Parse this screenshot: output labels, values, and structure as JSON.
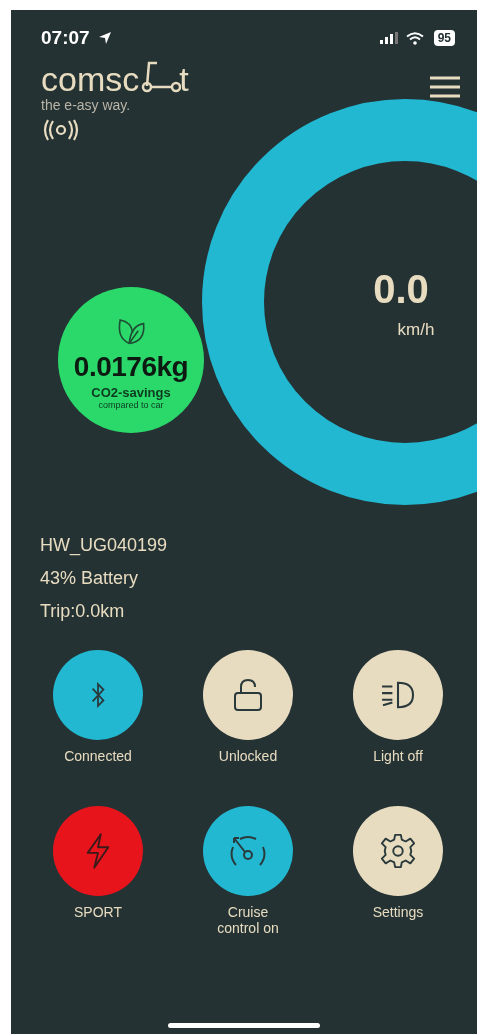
{
  "status_bar": {
    "time": "07:07",
    "battery": "95"
  },
  "logo": {
    "text_start": "comsc",
    "text_end": "t",
    "tagline": "the e-asy way."
  },
  "speed": {
    "value": "0.0",
    "unit": "km/h"
  },
  "co2": {
    "amount": "0.0176kg",
    "label": "CO2-savings",
    "note": "compared to car"
  },
  "device": {
    "name": "HW_UG040199",
    "battery": "43% Battery",
    "trip": "Trip:0.0km"
  },
  "controls": [
    {
      "kind": "bluetooth",
      "label": "Connected",
      "color": "#22b8d1"
    },
    {
      "kind": "lock",
      "label": "Unlocked",
      "color": "#e8dcc0"
    },
    {
      "kind": "headlight",
      "label": "Light off",
      "color": "#e8dcc0"
    },
    {
      "kind": "bolt",
      "label": "SPORT",
      "color": "#e8141c"
    },
    {
      "kind": "speedometer",
      "label": "Cruise control on",
      "color": "#22b8d1"
    },
    {
      "kind": "gear",
      "label": "Settings",
      "color": "#e8dcc0"
    }
  ]
}
